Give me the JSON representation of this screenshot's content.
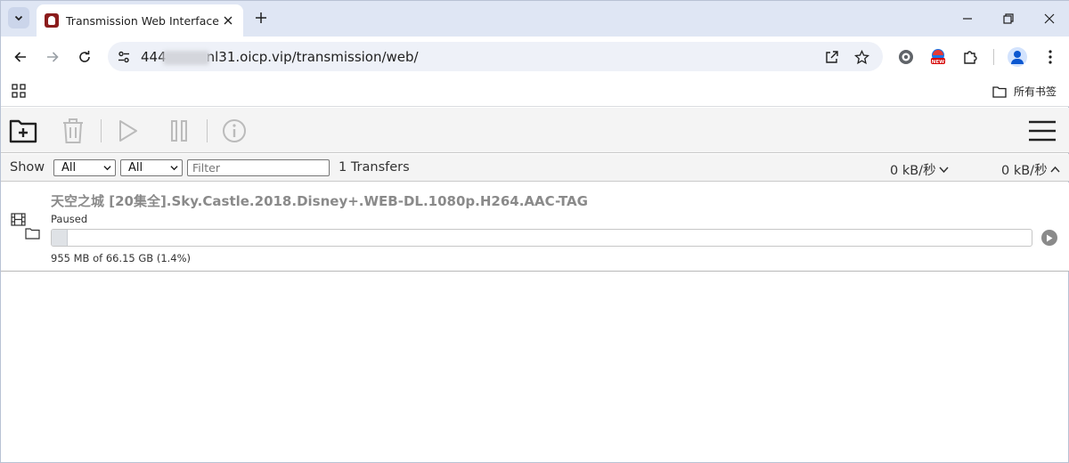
{
  "browser": {
    "tab_title": "Transmission Web Interface",
    "url": "444   nl31.oicp.vip/transmission/web/",
    "bookmarks_folder_label": "所有书签"
  },
  "transmission": {
    "filter": {
      "show_label": "Show",
      "status_select": "All",
      "tracker_select": "All",
      "filter_placeholder": "Filter",
      "transfers_count": "1 Transfers",
      "download_speed": "0 kB/秒",
      "upload_speed": "0 kB/秒"
    },
    "torrents": [
      {
        "name": "天空之城 [20集全].Sky.Castle.2018.Disney+.WEB-DL.1080p.H264.AAC-TAG",
        "status": "Paused",
        "progress_text": "955 MB of 66.15 GB (1.4%)",
        "progress_fraction": 0.014
      }
    ]
  },
  "colors": {
    "tabstrip_bg": "#dfe6f4",
    "omnibox_bg": "#eef1f8",
    "toolbar_bg": "#f4f4f4",
    "accent": "#0b57d0"
  }
}
